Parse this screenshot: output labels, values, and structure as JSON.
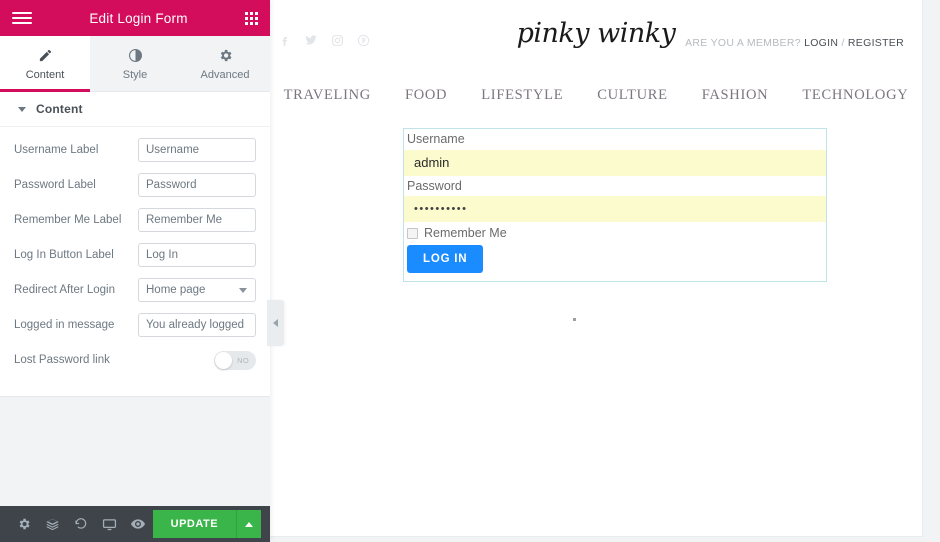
{
  "panel": {
    "header": {
      "title": "Edit Login Form",
      "menu_icon": "hamburger-icon",
      "grid_icon": "grid-apps-icon"
    },
    "tabs": [
      {
        "label": "Content",
        "icon": "pencil-icon",
        "active": true
      },
      {
        "label": "Style",
        "icon": "half-circle-icon",
        "active": false
      },
      {
        "label": "Advanced",
        "icon": "gear-icon",
        "active": false
      }
    ],
    "section": {
      "title": "Content"
    },
    "fields": [
      {
        "label": "Username Label",
        "type": "text",
        "value": "Username"
      },
      {
        "label": "Password Label",
        "type": "text",
        "value": "Password"
      },
      {
        "label": "Remember Me Label",
        "type": "text",
        "value": "Remember Me"
      },
      {
        "label": "Log In Button Label",
        "type": "text",
        "value": "Log In"
      },
      {
        "label": "Redirect After Login",
        "type": "select",
        "value": "Home page"
      },
      {
        "label": "Logged in message",
        "type": "text",
        "value": "You already logged in"
      },
      {
        "label": "Lost Password link",
        "type": "switch",
        "value": "NO"
      }
    ],
    "footer": {
      "icons": [
        "gear-icon",
        "layers-icon",
        "history-revert-icon",
        "responsive-monitor-icon",
        "eye-preview-icon"
      ],
      "update_label": "UPDATE",
      "update_caret_icon": "chevron-up-icon"
    },
    "collapse_handle_icon": "chevron-left-icon"
  },
  "preview": {
    "socials": [
      "facebook-icon",
      "twitter-icon",
      "instagram-icon",
      "pinterest-icon"
    ],
    "logo": "pinky winky",
    "member": {
      "prompt": "ARE YOU A MEMBER?",
      "login": "LOGIN",
      "separator": "/",
      "register": "REGISTER"
    },
    "nav": [
      "TRAVELING",
      "FOOD",
      "LIFESTYLE",
      "CULTURE",
      "FASHION",
      "TECHNOLOGY"
    ],
    "login_form": {
      "username_label": "Username",
      "username_value": "admin",
      "password_label": "Password",
      "password_value": "••••••••••",
      "remember_label": "Remember Me",
      "button_label": "LOG IN"
    }
  },
  "colors": {
    "brand_pink": "#d30c5c",
    "update_green": "#39b54a",
    "footer_dark": "#3f444b",
    "form_border": "#bfe3e8",
    "autofill_yellow": "#fbfbcd",
    "login_blue": "#1a8cff"
  }
}
